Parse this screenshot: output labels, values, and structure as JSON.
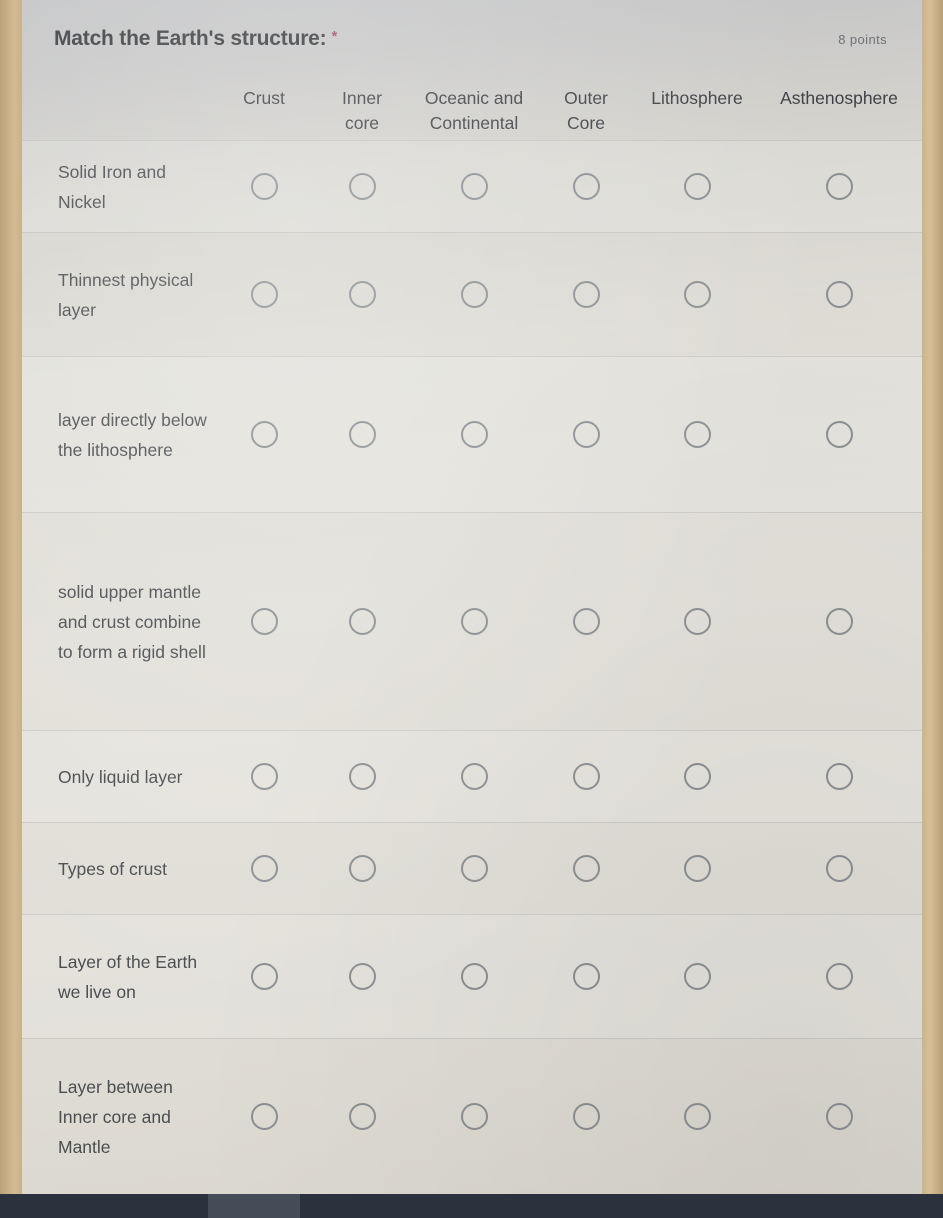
{
  "question": {
    "title": "Match the Earth's structure:",
    "required_marker": "*",
    "points": "8 points"
  },
  "columns": [
    {
      "id": "crust",
      "label": "Crust"
    },
    {
      "id": "inner-core",
      "label": "Inner\ncore"
    },
    {
      "id": "oceanic-continental",
      "label": "Oceanic and\nContinental"
    },
    {
      "id": "outer-core",
      "label": "Outer\nCore"
    },
    {
      "id": "lithosphere",
      "label": "Lithosphere"
    },
    {
      "id": "asthenosphere",
      "label": "Asthenosphere"
    }
  ],
  "rows": [
    {
      "id": "solid-iron-and-nickel",
      "label": "Solid Iron and Nickel",
      "selected": null
    },
    {
      "id": "thinnest-physical-layer",
      "label": "Thinnest physical layer",
      "selected": null
    },
    {
      "id": "layer-directly-below-lithosphere",
      "label": "layer directly below the lithosphere",
      "selected": null
    },
    {
      "id": "solid-upper-mantle-and-crust",
      "label": "solid upper mantle and crust combine to form a rigid shell",
      "selected": null
    },
    {
      "id": "only-liquid-layer",
      "label": "Only liquid layer",
      "selected": null
    },
    {
      "id": "types-of-crust",
      "label": "Types of crust",
      "selected": null
    },
    {
      "id": "layer-of-earth-we-live-on",
      "label": "Layer of the Earth we live on",
      "selected": null
    },
    {
      "id": "layer-between-inner-core-and-mantle",
      "label": "Layer between Inner core and Mantle",
      "selected": null
    }
  ],
  "colors": {
    "required_asterisk": "#a8515f",
    "page_background": "#dedad2",
    "text": "#4a4d51",
    "radio_border": "#8b8f93",
    "bottom_bar": "#2b323d",
    "desk_edge": "#cbb48d"
  }
}
